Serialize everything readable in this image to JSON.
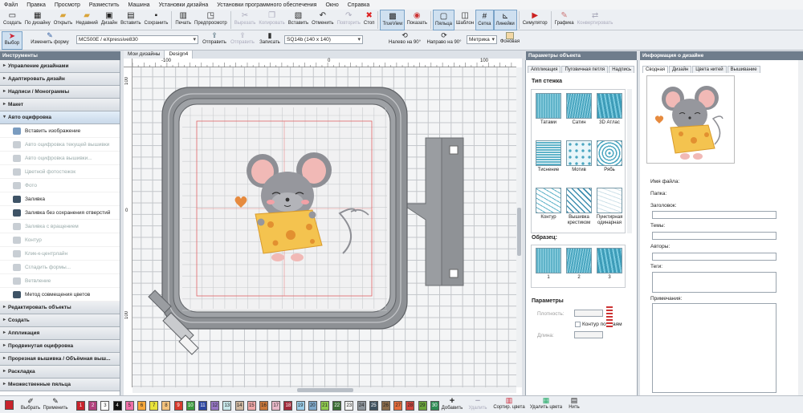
{
  "menu": [
    "Файл",
    "Правка",
    "Просмотр",
    "Разместить",
    "Машина",
    "Установки дизайна",
    "Установки программного обеспечения",
    "Окно",
    "Справка"
  ],
  "toolbar": [
    {
      "label": "Создать",
      "icon": "new-file-icon"
    },
    {
      "label": "По дизайну",
      "icon": "design-template-icon"
    },
    {
      "label": "Открыть",
      "icon": "open-folder-icon"
    },
    {
      "label": "Недавний",
      "icon": "recent-folder-icon"
    },
    {
      "label": "Дизайн",
      "icon": "design-icon"
    },
    {
      "label": "Вставить",
      "icon": "insert-icon"
    },
    {
      "label": "Сохранить",
      "icon": "save-icon"
    },
    {
      "label": "Печать",
      "icon": "print-icon"
    },
    {
      "label": "Предпросмотр",
      "icon": "preview-icon"
    },
    {
      "label": "Вырезать",
      "icon": "cut-icon",
      "disabled": true
    },
    {
      "label": "Копировать",
      "icon": "copy-icon",
      "disabled": true
    },
    {
      "label": "Вставить",
      "icon": "paste-icon"
    },
    {
      "label": "Отменить",
      "icon": "undo-icon"
    },
    {
      "label": "Повторить",
      "icon": "redo-icon",
      "disabled": true
    },
    {
      "label": "Стоп",
      "icon": "stop-icon"
    },
    {
      "label": "TrueView",
      "icon": "trueview-icon",
      "active": true
    },
    {
      "label": "Показать",
      "icon": "show-icon"
    },
    {
      "label": "Пяльца",
      "icon": "hoop-icon",
      "active": true
    },
    {
      "label": "Шаблон",
      "icon": "template-icon"
    },
    {
      "label": "Сетка",
      "icon": "grid-icon",
      "active": true
    },
    {
      "label": "Линейки",
      "icon": "rulers-icon",
      "active": true
    },
    {
      "label": "Симулятор",
      "icon": "simulator-icon"
    },
    {
      "label": "Графика",
      "icon": "graphics-icon"
    },
    {
      "label": "Конвертировать",
      "icon": "convert-icon",
      "disabled": true
    }
  ],
  "toolbar2": {
    "select": "Выбор",
    "change_shape": "Изменить форму",
    "machine": "MC500E / eXpressive830",
    "send": "Отправить",
    "send2": "Отправить",
    "write": "Записать",
    "hoop": "SQ14b (140 x 140)",
    "rotate_left": "Налево на 90°",
    "rotate_right": "Направо на 90°",
    "units": "Метрика",
    "background": "Фоновая"
  },
  "left_panel": {
    "title": "Инструменты",
    "sections": [
      "Управление дизайнами",
      "Адаптировать дизайн",
      "Надписи / Монограммы",
      "Макет",
      "Авто оцифровка"
    ],
    "auto_items": [
      {
        "label": "Вставить изображение",
        "disabled": false
      },
      {
        "label": "Авто оцифровка текущей вышивки",
        "disabled": true
      },
      {
        "label": "Авто оцифровка вышивки...",
        "disabled": true
      },
      {
        "label": "Цветной фотостежок",
        "disabled": true
      },
      {
        "label": "Фото",
        "disabled": true
      },
      {
        "label": "Заливка",
        "disabled": false
      },
      {
        "label": "Заливка без сохранения отверстий",
        "disabled": false
      },
      {
        "label": "Заливка с вращением",
        "disabled": true
      },
      {
        "label": "Контур",
        "disabled": true
      },
      {
        "label": "Клик-к-центрлайн",
        "disabled": true
      },
      {
        "label": "Сгладить формы...",
        "disabled": true
      },
      {
        "label": "Ветвление",
        "disabled": true
      },
      {
        "label": "Метод совмещения цветов",
        "disabled": false
      }
    ],
    "sections_after": [
      "Редактировать объекты",
      "Создать",
      "Аппликация",
      "Продвинутая оцифровка",
      "Прорезная вышивка / Объёмная выш...",
      "Раскладка",
      "Множественные пяльца"
    ]
  },
  "center": {
    "tabs": [
      "Мои дизайны",
      "Design4"
    ],
    "ruler_h": [
      "-100",
      "0",
      "100"
    ],
    "ruler_v": [
      "100",
      "0",
      "100"
    ]
  },
  "object_panel": {
    "title": "Параметры объекта",
    "tabs": [
      "Аппликация",
      "Пуговичная петля",
      "Надпись"
    ],
    "stitch_type_title": "Тип стежка",
    "stitches": [
      "Татами",
      "Сатин",
      "3D Атлас",
      "Тиснение",
      "Мотив",
      "Рябь",
      "Контур",
      "Вышивка крестиком",
      "Пунктирная одинарная"
    ],
    "sample_title": "Образец:",
    "samples": [
      "1",
      "2",
      "3"
    ],
    "params_title": "Параметры",
    "density": "Плотность:",
    "contour": "Контур по краям",
    "length": "Длина:"
  },
  "info_panel": {
    "title": "Информация о дизайне",
    "tabs": [
      "Сводная",
      "Дизайн",
      "Цвета нитей",
      "Вышивание"
    ],
    "file_name": "Имя файла:",
    "folder": "Папка:",
    "heading": "Заголовок:",
    "topics": "Темы:",
    "authors": "Авторы:",
    "tags": "Теги:",
    "notes": "Примечания:"
  },
  "bottom": {
    "select_label": "Выбрать",
    "apply_label": "Применить",
    "add_label": "Добавить",
    "remove_label": "Удалить",
    "sort_label": "Сортир. цвета",
    "delete_label": "Удалить цвета",
    "apply_bar_label": "Нить",
    "swatches": [
      {
        "n": "1",
        "c": "#c8232c"
      },
      {
        "n": "2",
        "c": "#b0417c"
      },
      {
        "n": "3",
        "c": "#ffffff"
      },
      {
        "n": "4",
        "c": "#101010"
      },
      {
        "n": "5",
        "c": "#f06fa8"
      },
      {
        "n": "6",
        "c": "#f7a83b"
      },
      {
        "n": "7",
        "c": "#e8e23a"
      },
      {
        "n": "8",
        "c": "#f3c27d"
      },
      {
        "n": "9",
        "c": "#d63a2d"
      },
      {
        "n": "10",
        "c": "#3b9a3e"
      },
      {
        "n": "11",
        "c": "#2c46a0"
      },
      {
        "n": "12",
        "c": "#9576c2"
      },
      {
        "n": "13",
        "c": "#c7e7ea"
      },
      {
        "n": "14",
        "c": "#cfb7a0"
      },
      {
        "n": "15",
        "c": "#f0a8a8"
      },
      {
        "n": "16",
        "c": "#c9773a"
      },
      {
        "n": "17",
        "c": "#e9b9c9"
      },
      {
        "n": "18",
        "c": "#a12a3b"
      },
      {
        "n": "19",
        "c": "#9ccde8"
      },
      {
        "n": "20",
        "c": "#7fa8c9"
      },
      {
        "n": "21",
        "c": "#8fc94f"
      },
      {
        "n": "22",
        "c": "#3b6d35"
      },
      {
        "n": "23",
        "c": "#f3f3f3"
      },
      {
        "n": "24",
        "c": "#8d949b"
      },
      {
        "n": "25",
        "c": "#3e5160"
      },
      {
        "n": "26",
        "c": "#8a6c4c"
      },
      {
        "n": "27",
        "c": "#e36b3b"
      },
      {
        "n": "28",
        "c": "#d0463e"
      },
      {
        "n": "29",
        "c": "#6aa43b"
      },
      {
        "n": "30",
        "c": "#2f8c55"
      }
    ]
  },
  "colors": {
    "accent": "#6f7d8c",
    "hoop": "#8c8f93"
  }
}
